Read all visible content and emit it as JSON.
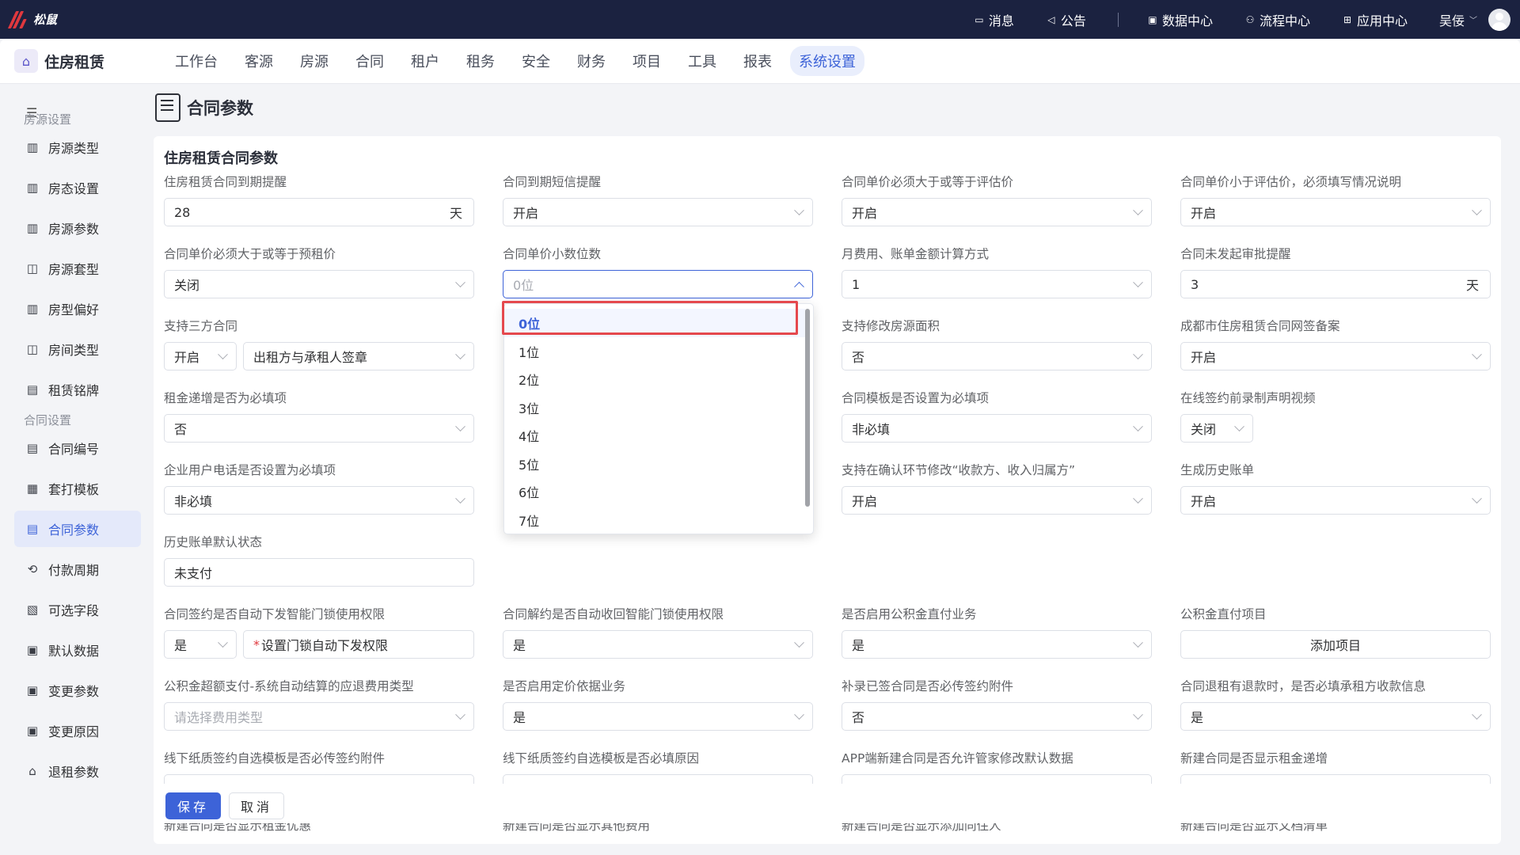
{
  "topbar": {
    "logo_text": "松鼠",
    "items": [
      {
        "icon": "message-icon",
        "label": "消息"
      },
      {
        "icon": "speaker-icon",
        "label": "公告"
      },
      {
        "icon": "data-center-icon",
        "label": "数据中心"
      },
      {
        "icon": "workflow-icon",
        "label": "流程中心"
      },
      {
        "icon": "apps-icon",
        "label": "应用中心"
      }
    ],
    "user_name": "吴佞"
  },
  "navbar": {
    "brand": "住房租赁",
    "tabs": [
      "工作台",
      "客源",
      "房源",
      "合同",
      "租户",
      "租务",
      "安全",
      "财务",
      "项目",
      "工具",
      "报表",
      "系统设置"
    ],
    "active_tab": "系统设置"
  },
  "sidebar": {
    "groups": [
      {
        "title": "房源设置",
        "items": [
          "房源类型",
          "房态设置",
          "房源参数",
          "房源套型",
          "房型偏好",
          "房间类型",
          "租赁铭牌"
        ]
      },
      {
        "title": "合同设置",
        "items": [
          "合同编号",
          "套打模板",
          "合同参数",
          "付款周期",
          "可选字段",
          "默认数据",
          "变更参数",
          "变更原因",
          "退租参数"
        ]
      }
    ],
    "active_item": "合同参数"
  },
  "page": {
    "title": "合同参数",
    "section_title": "住房租赁合同参数"
  },
  "fields": {
    "r1c1": {
      "label": "住房租赁合同到期提醒",
      "value": "28",
      "suffix": "天"
    },
    "r1c2": {
      "label": "合同到期短信提醒",
      "value": "开启"
    },
    "r1c3": {
      "label": "合同单价必须大于或等于评估价",
      "value": "开启"
    },
    "r1c4": {
      "label": "合同单价小于评估价，必须填写情况说明",
      "value": "开启"
    },
    "r2c1": {
      "label": "合同单价必须大于或等于预租价",
      "value": "关闭"
    },
    "r2c2": {
      "label": "合同单价小数位数",
      "placeholder": "0位"
    },
    "r2c3": {
      "label": "月费用、账单金额计算方式",
      "value": "1"
    },
    "r2c4": {
      "label": "合同未发起审批提醒",
      "value": "3",
      "suffix": "天"
    },
    "r3c1": {
      "label": "支持三方合同",
      "value": "开启",
      "value2": "出租方与承租人签章"
    },
    "r3c3": {
      "label": "支持修改房源面积",
      "value": "否"
    },
    "r3c4": {
      "label": "成都市住房租赁合同网签备案",
      "value": "开启"
    },
    "r4c1": {
      "label": "租金递增是否为必填项",
      "value": "否"
    },
    "r4c3": {
      "label": "合同模板是否设置为必填项",
      "value": "非必填"
    },
    "r4c4": {
      "label": "在线签约前录制声明视频",
      "value": "关闭"
    },
    "r5c1": {
      "label": "企业用户电话是否设置为必填项",
      "value": "非必填"
    },
    "r5c3": {
      "label": "支持在确认环节修改“收款方、收入归属方”",
      "value": "开启"
    },
    "r5c4": {
      "label": "生成历史账单",
      "value": "开启"
    },
    "r6c1": {
      "label": "历史账单默认状态",
      "value": "未支付"
    },
    "r7c1": {
      "label": "合同签约是否自动下发智能门锁使用权限",
      "value": "是",
      "value2": "设置门锁自动下发权限",
      "required_mark": "*"
    },
    "r7c2": {
      "label": "合同解约是否自动收回智能门锁使用权限",
      "value": "是"
    },
    "r7c3": {
      "label": "是否启用公积金直付业务",
      "value": "是"
    },
    "r7c4": {
      "label": "公积金直付项目",
      "button": "添加项目"
    },
    "r8c1": {
      "label": "公积金超额支付-系统自动结算的应退费用类型",
      "placeholder": "请选择费用类型"
    },
    "r8c2": {
      "label": "是否启用定价依据业务",
      "value": "是"
    },
    "r8c3": {
      "label": "补录已签合同是否必传签约附件",
      "value": "否"
    },
    "r8c4": {
      "label": "合同退租有退款时，是否必填承租方收款信息",
      "value": "是"
    },
    "r9c1": {
      "label": "线下纸质签约自选模板是否必传签约附件"
    },
    "r9c2": {
      "label": "线下纸质签约自选模板是否必填原因"
    },
    "r9c3": {
      "label": "APP端新建合同是否允许管家修改默认数据"
    },
    "r9c4": {
      "label": "新建合同是否显示租金递增"
    },
    "r10c1": {
      "label": "新建合同是否显示租金优惠"
    },
    "r10c2": {
      "label": "新建合同是否显示其他费用"
    },
    "r10c3": {
      "label": "新建合同是否显示添加同住人"
    },
    "r10c4": {
      "label": "新建合同是否显示文档清单"
    }
  },
  "dropdown": {
    "options": [
      "0位",
      "1位",
      "2位",
      "3位",
      "4位",
      "5位",
      "6位",
      "7位"
    ],
    "selected": "0位"
  },
  "footer": {
    "save_label": "保存",
    "cancel_label": "取消"
  },
  "colors": {
    "topbar_bg": "#1b2240",
    "primary": "#3d63d8",
    "highlight": "#e5484d"
  }
}
